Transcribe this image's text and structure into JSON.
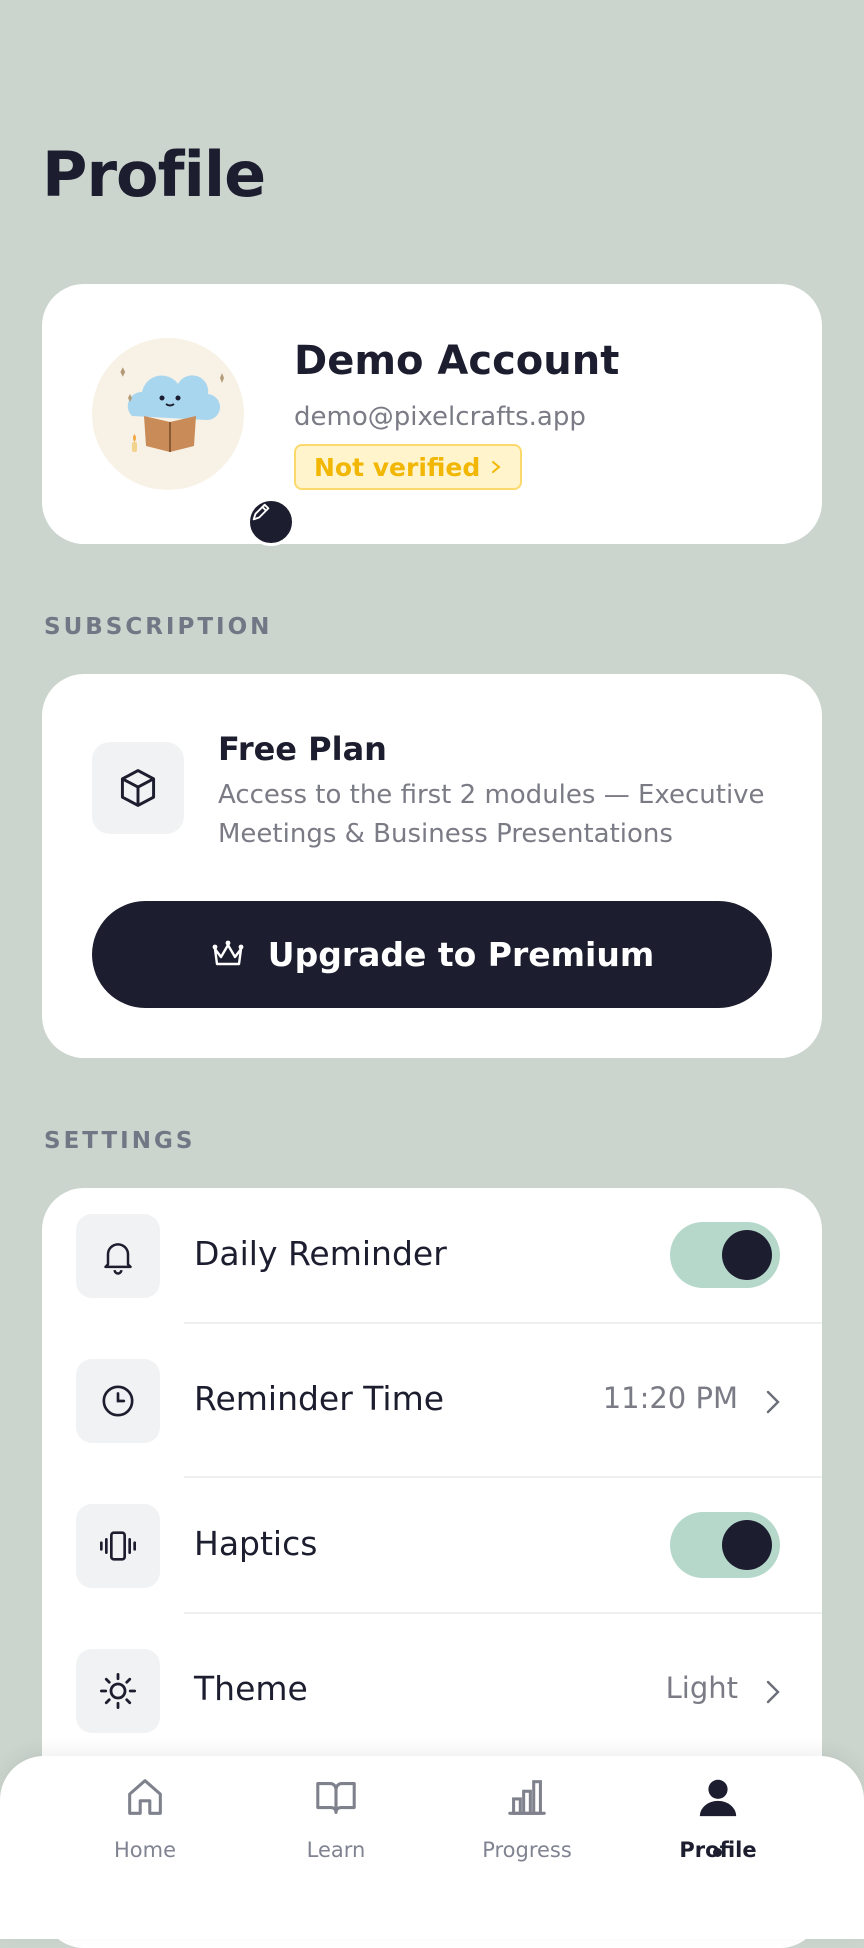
{
  "page": {
    "title": "Profile"
  },
  "profile": {
    "name": "Demo Account",
    "email": "demo@pixelcrafts.app",
    "verification": {
      "label": "Not verified",
      "color": "#f2b705"
    },
    "avatar_icon": "reading-cloud-avatar",
    "edit_icon": "pencil-icon"
  },
  "subscription": {
    "section_label": "SUBSCRIPTION",
    "plan_icon": "cube-icon",
    "plan_title": "Free Plan",
    "plan_description": "Access to the first 2 modules — Executive Meetings & Business Presentations",
    "upgrade_icon": "crown-icon",
    "upgrade_label": "Upgrade to Premium"
  },
  "settings": {
    "section_label": "SETTINGS",
    "items": [
      {
        "icon": "bell-icon",
        "label": "Daily Reminder",
        "type": "toggle",
        "enabled": true
      },
      {
        "icon": "clock-icon",
        "label": "Reminder Time",
        "type": "value",
        "value": "11:20 PM"
      },
      {
        "icon": "vibrate-icon",
        "label": "Haptics",
        "type": "toggle",
        "enabled": true
      },
      {
        "icon": "sun-icon",
        "label": "Theme",
        "type": "value",
        "value": "Light"
      }
    ]
  },
  "tabbar": {
    "items": [
      {
        "icon": "home-icon",
        "label": "Home",
        "active": false
      },
      {
        "icon": "book-icon",
        "label": "Learn",
        "active": false
      },
      {
        "icon": "bar-chart-icon",
        "label": "Progress",
        "active": false
      },
      {
        "icon": "user-icon",
        "label": "Profile",
        "active": true
      }
    ]
  },
  "colors": {
    "background": "#cbd5ce",
    "card": "#ffffff",
    "primary_dark": "#1c1d2e",
    "toggle_on": "#b5d8cb",
    "muted_text": "#7a7b85",
    "warning_bg": "#fff4cc"
  }
}
